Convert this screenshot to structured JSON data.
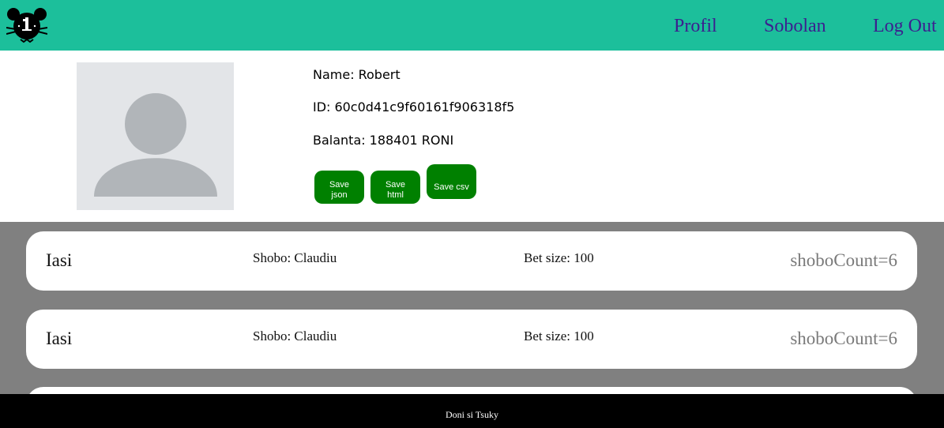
{
  "nav": {
    "links": [
      "Profil",
      "Sobolan",
      "Log Out"
    ]
  },
  "profile": {
    "name_label": "Name:",
    "name": "Robert",
    "id_label": "ID:",
    "id": "60c0d41c9f60161f906318f5",
    "balance_label": "Balanta:",
    "balance": "188401 RONI",
    "buttons": {
      "json_line1": "Save",
      "json_line2": "json",
      "html_line1": "Save",
      "html_line2": "html",
      "csv": "Save csv"
    }
  },
  "bets": [
    {
      "city": "Iasi",
      "shobo": "Shobo: Claudiu",
      "bet_size": "Bet size: 100",
      "count": "shoboCount=6"
    },
    {
      "city": "Iasi",
      "shobo": "Shobo: Claudiu",
      "bet_size": "Bet size: 100",
      "count": "shoboCount=6"
    }
  ],
  "footer": {
    "text": "Doni si Tsuky"
  },
  "colors": {
    "navbar": "#1cbf9b",
    "nav_link": "#3c1f8f",
    "save_button": "#008000",
    "list_background": "#808080",
    "footer": "#000000"
  },
  "icons": {
    "logo": "mouse-clock-logo-icon",
    "avatar": "user-placeholder-icon"
  }
}
